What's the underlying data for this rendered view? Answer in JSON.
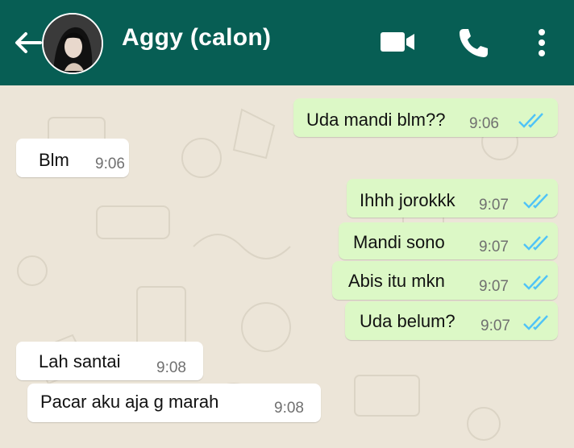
{
  "header": {
    "contact_name": "Aggy (calon)",
    "icons": [
      "back-arrow-icon",
      "video-call-icon",
      "phone-call-icon",
      "more-options-icon"
    ],
    "color": "#075e54"
  },
  "messages": [
    {
      "direction": "outgoing",
      "text": "Uda mandi blm??",
      "time": "9:06",
      "status": "read"
    },
    {
      "direction": "incoming",
      "text": "Blm",
      "time": "9:06"
    },
    {
      "direction": "outgoing",
      "text": "Ihhh jorokkk",
      "time": "9:07",
      "status": "read"
    },
    {
      "direction": "outgoing",
      "text": "Mandi sono",
      "time": "9:07",
      "status": "read"
    },
    {
      "direction": "outgoing",
      "text": "Abis itu mkn",
      "time": "9:07",
      "status": "read"
    },
    {
      "direction": "outgoing",
      "text": "Uda belum?",
      "time": "9:07",
      "status": "read"
    },
    {
      "direction": "incoming",
      "text": "Lah santai",
      "time": "9:08"
    },
    {
      "direction": "incoming",
      "text": "Pacar aku aja g marah",
      "time": "9:08"
    }
  ],
  "colors": {
    "outgoing_bubble": "#dcf8c6",
    "incoming_bubble": "#ffffff",
    "read_tick": "#4fc3f7",
    "chat_background": "#ece5d8"
  }
}
